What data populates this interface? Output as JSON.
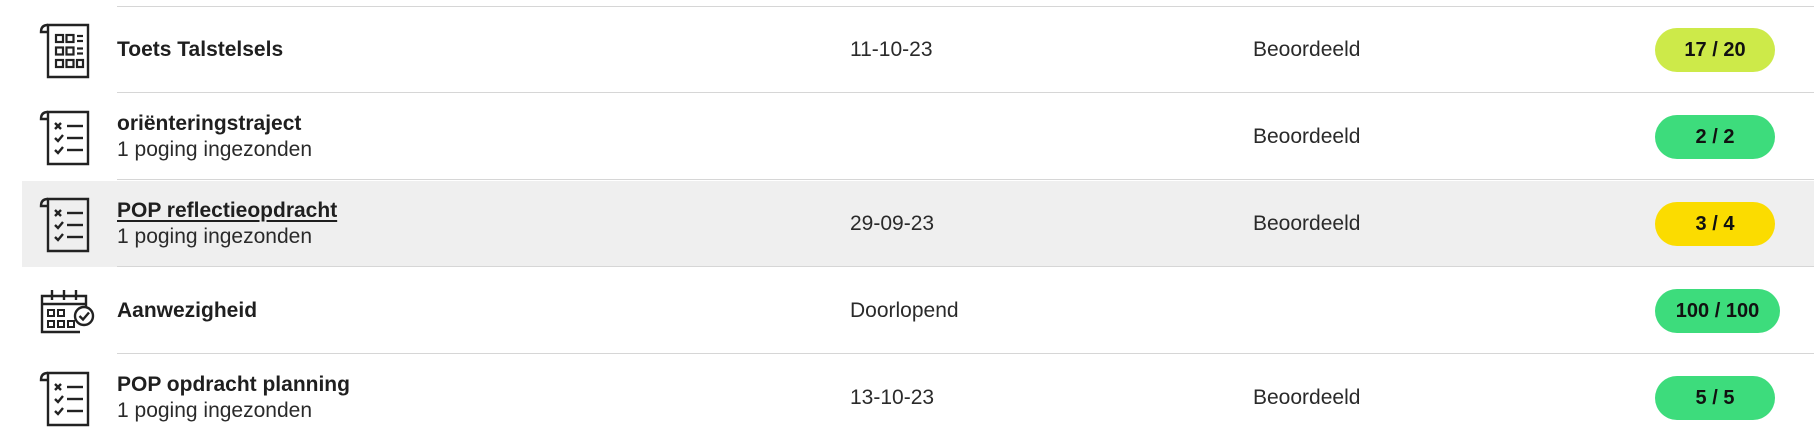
{
  "rows": [
    {
      "title": "Toets Talstelsels",
      "subtitle": "",
      "date": "11-10-23",
      "status": "Beoordeeld",
      "score": "17 / 20",
      "score_color": "#cdea49",
      "icon": "calculator-grid-icon"
    },
    {
      "title": "oriënteringstraject",
      "subtitle": "1 poging ingezonden",
      "date": "",
      "status": "Beoordeeld",
      "score": "2 / 2",
      "score_color": "#3ddc7c",
      "icon": "checklist-icon"
    },
    {
      "title": "POP reflectieopdracht",
      "subtitle": "1 poging ingezonden",
      "date": "29-09-23",
      "status": "Beoordeeld",
      "score": "3 / 4",
      "score_color": "#fbdc00",
      "icon": "checklist-icon"
    },
    {
      "title": "Aanwezigheid",
      "subtitle": "",
      "date": "Doorlopend",
      "status": "",
      "score": "100 / 100",
      "score_color": "#3ddc7c",
      "icon": "calendar-check-icon"
    },
    {
      "title": "POP opdracht planning",
      "subtitle": "1 poging ingezonden",
      "date": "13-10-23",
      "status": "Beoordeeld",
      "score": "5 / 5",
      "score_color": "#3ddc7c",
      "icon": "checklist-icon"
    }
  ]
}
